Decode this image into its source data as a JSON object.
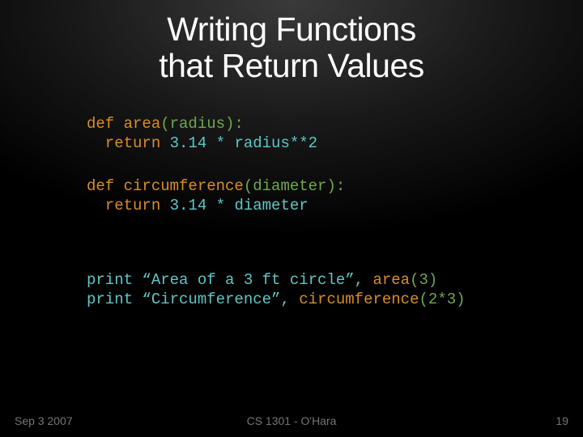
{
  "title_line1": "Writing Functions",
  "title_line2": "that Return Values",
  "code": {
    "area_def": "def area",
    "area_params": "(radius):",
    "area_ret": "  return ",
    "area_expr": "3.14 * radius**2",
    "circ_def": "def circumference",
    "circ_params": "(diameter):",
    "circ_ret": "  return ",
    "circ_expr": "3.14 * diameter",
    "p1_a": "print “Area of a 3 ft circle”, ",
    "p1_b": "area",
    "p1_c": "(3)",
    "p2_a": "print “Circumference”, ",
    "p2_b": "circumference",
    "p2_c": "(2*3)"
  },
  "footer": {
    "date": "Sep 3 2007",
    "course": "CS 1301 - O'Hara",
    "page": "19"
  }
}
